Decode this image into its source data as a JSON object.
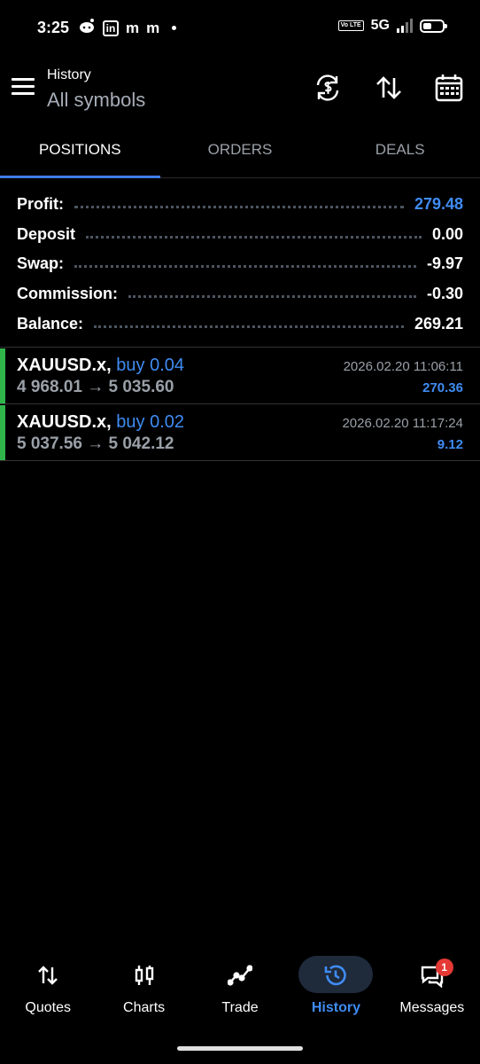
{
  "status_bar": {
    "time": "3:25",
    "left_icons": [
      "reddit-icon",
      "linkedin-icon",
      "m-icon",
      "m-icon"
    ],
    "volte": "Vo LTE",
    "network": "5G",
    "battery_level": 0.45
  },
  "header": {
    "subtitle": "History",
    "title": "All symbols"
  },
  "tabs": [
    {
      "label": "POSITIONS",
      "active": true
    },
    {
      "label": "ORDERS",
      "active": false
    },
    {
      "label": "DEALS",
      "active": false
    }
  ],
  "summary": [
    {
      "label": "Profit:",
      "value": "279.48"
    },
    {
      "label": "Deposit",
      "value": "0.00"
    },
    {
      "label": "Swap:",
      "value": "-9.97"
    },
    {
      "label": "Commission:",
      "value": "-0.30"
    },
    {
      "label": "Balance:",
      "value": "269.21"
    }
  ],
  "positions": [
    {
      "symbol": "XAUUSD.x,",
      "side": "buy 0.04",
      "prices": "4 968.01 → 5 035.60",
      "time": "2026.02.20 11:06:11",
      "profit": "270.36"
    },
    {
      "symbol": "XAUUSD.x,",
      "side": "buy 0.02",
      "prices": "5 037.56 → 5 042.12",
      "time": "2026.02.20 11:17:24",
      "profit": "9.12"
    }
  ],
  "bottom_nav": [
    {
      "label": "Quotes",
      "icon": "sort-arrows-icon"
    },
    {
      "label": "Charts",
      "icon": "candlestick-icon"
    },
    {
      "label": "Trade",
      "icon": "trend-line-icon"
    },
    {
      "label": "History",
      "icon": "history-clock-icon",
      "active": true
    },
    {
      "label": "Messages",
      "icon": "chat-icon",
      "badge": "1"
    }
  ],
  "colors": {
    "accent": "#3f8cf3",
    "buy_bar": "#2fb54a",
    "background": "#000000",
    "muted_text": "#9aa0a8"
  }
}
